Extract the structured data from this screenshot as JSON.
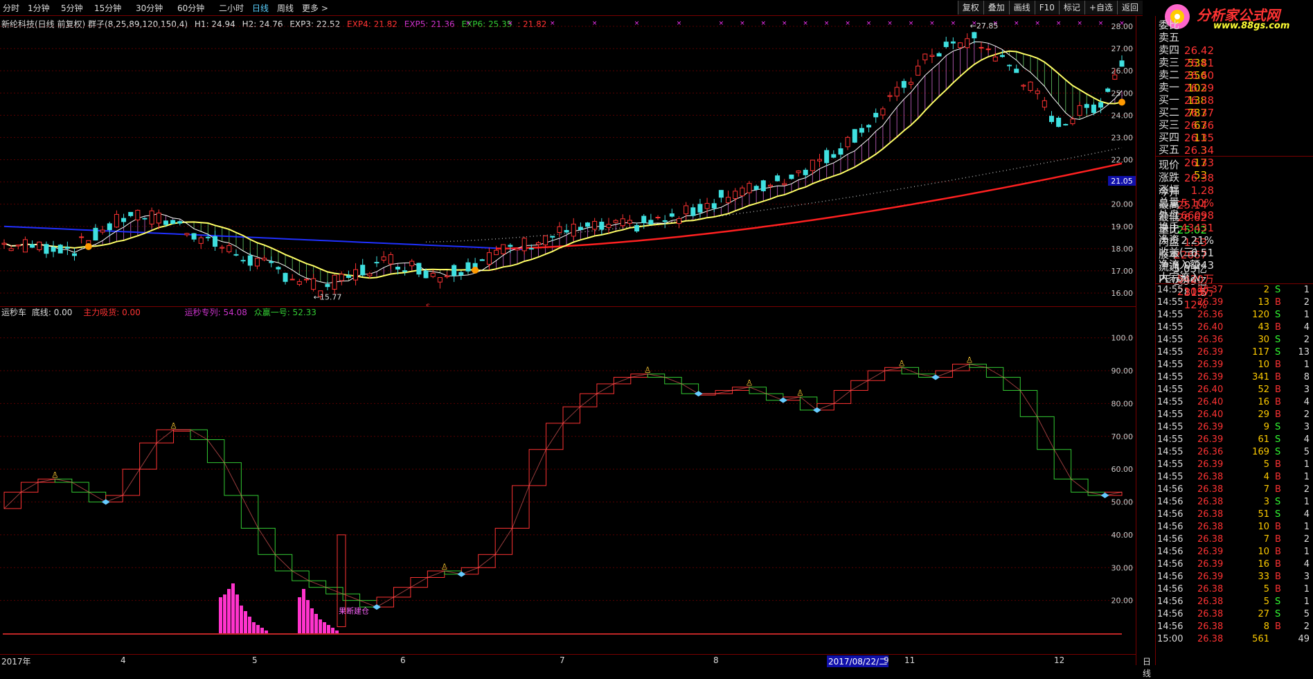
{
  "toolbar": {
    "periods": [
      "分时",
      "1分钟",
      "5分钟",
      "15分钟",
      "30分钟",
      "60分钟",
      "二小时",
      "日线",
      "周线",
      "更多 >"
    ],
    "active_period": "日线",
    "right_buttons": [
      "复权",
      "叠加",
      "画线",
      "F10",
      "标记",
      "+自选",
      "返回"
    ]
  },
  "logo": {
    "name": "分析家公式网",
    "url": "www.88gs.com"
  },
  "main_info": {
    "stock": "新纶科技(日线 前复权)",
    "indicator": "群子(8,25,89,120,150,4)",
    "h1": "H1: 24.94",
    "h2": "H2: 24.76",
    "exp3": "EXP3: 22.52",
    "exp4": "EXP4: 21.82",
    "exp5": "EXP5: 21.36",
    "exp6": "EXP6: 25.35",
    "extra": ": 21.82"
  },
  "sub_info": {
    "name": "运秒车",
    "base": "底线: 0.00",
    "main_force": "主力吸货: 0.00",
    "run": "运秒专列: 54.08",
    "crowd": "众赢一号: 52.33"
  },
  "main_chart": {
    "type": "candlestick",
    "y_ticks": [
      "28.00",
      "27.00",
      "26.00",
      "25.00",
      "24.00",
      "23.00",
      "22.00",
      "21.00",
      "20.00",
      "19.00",
      "18.00",
      "17.00",
      "16.00"
    ],
    "ylim": [
      16,
      28
    ],
    "price_marker": "21.05",
    "annotations": {
      "high": "27.85",
      "low": "15.77",
      "s_mark": "S"
    },
    "colors": {
      "up": "#ff3333",
      "down": "#3fe0e0",
      "ma1": "#ffffff",
      "ma2": "#ffff66",
      "ma3": "#ff2020",
      "ma4": "#2030ff"
    }
  },
  "sub_chart": {
    "type": "line",
    "y_ticks": [
      "100.0",
      "90.00",
      "80.00",
      "70.00",
      "60.00",
      "50.00",
      "40.00",
      "30.00",
      "20.00"
    ],
    "ylim": [
      10,
      105
    ],
    "buy_label": "果断建仓",
    "colors": {
      "up": "#ff3333",
      "down": "#33cc33",
      "bars": "#ff33cc"
    }
  },
  "chart_data": {
    "type": "line",
    "title": "",
    "series": [
      {
        "name": "运秒专列",
        "values": [
          48,
          53,
          56,
          57,
          56,
          53,
          50,
          52,
          60,
          68,
          72,
          72,
          69,
          62,
          52,
          42,
          34,
          29,
          26,
          24,
          22,
          20,
          18,
          21,
          24,
          27,
          29,
          28,
          30,
          34,
          42,
          55,
          66,
          74,
          79,
          83,
          86,
          88,
          89,
          88,
          86,
          83,
          83,
          84,
          85,
          83,
          81,
          82,
          78,
          80,
          84,
          87,
          90,
          91,
          89,
          88,
          90,
          92,
          91,
          88,
          84,
          76,
          66,
          57,
          53,
          52,
          53
        ]
      }
    ],
    "ylim": [
      10,
      105
    ]
  },
  "axis": {
    "labels": [
      "2017年",
      "4",
      "5",
      "6",
      "7",
      "8",
      "2017/08/22/二",
      "9",
      "11",
      "12"
    ],
    "period_label": "日线"
  },
  "quote": {
    "asks": [
      {
        "label": "委比",
        "price": "",
        "vol": ""
      },
      {
        "label": "卖五",
        "price": "26.42",
        "vol": "538"
      },
      {
        "label": "卖四",
        "price": "26.41",
        "vol": "356"
      },
      {
        "label": "卖三",
        "price": "26.40",
        "vol": "102"
      },
      {
        "label": "卖二",
        "price": "26.39",
        "vol": "138"
      },
      {
        "label": "卖一",
        "price": "26.38",
        "vol": "787"
      }
    ],
    "bids": [
      {
        "label": "买一",
        "price": "26.37",
        "vol": "67"
      },
      {
        "label": "买二",
        "price": "26.36",
        "vol": "11"
      },
      {
        "label": "买三",
        "price": "26.35",
        "vol": "3"
      },
      {
        "label": "买四",
        "price": "26.34",
        "vol": "17"
      },
      {
        "label": "买五",
        "price": "26.33",
        "vol": "53"
      }
    ],
    "stats": [
      {
        "l1": "现价",
        "v1": "26.38",
        "l2": "今开",
        "v2": "25.14"
      },
      {
        "l1": "涨跌",
        "v1": "1.28",
        "l2": "最高",
        "v2": "26.62"
      },
      {
        "l1": "涨幅",
        "v1": "5.10%",
        "l2": "最低",
        "v2": "25.02"
      },
      {
        "l1": "总量",
        "v1": "66098",
        "l2": "量比",
        "v2": "1.53"
      },
      {
        "l1": "外盘",
        "v1": "43431",
        "l2": "内盘",
        "v2": "22667"
      },
      {
        "l1": "换手",
        "v1": "2.21%",
        "l2": "股本",
        "v2": "5.03亿"
      },
      {
        "l1": "净资",
        "v1": "6.51",
        "l2": "流通",
        "v2": "2.99亿"
      },
      {
        "l1": "收益(三)",
        "v1": "0.243",
        "l2": "PE(动)",
        "v2": "81.5"
      },
      {
        "l1": "净流入额",
        "v1": "5420万",
        "l2": "",
        "v2": "31%"
      },
      {
        "l1": "大宗流入",
        "v1": "2103万",
        "l2": "",
        "v2": "12%"
      }
    ],
    "ticks": [
      {
        "t": "14:55",
        "p": "26.37",
        "v": "2",
        "s": "S",
        "n": "1"
      },
      {
        "t": "14:55",
        "p": "26.39",
        "v": "13",
        "s": "B",
        "n": "2"
      },
      {
        "t": "14:55",
        "p": "26.36",
        "v": "120",
        "s": "S",
        "n": "1"
      },
      {
        "t": "14:55",
        "p": "26.40",
        "v": "43",
        "s": "B",
        "n": "4"
      },
      {
        "t": "14:55",
        "p": "26.36",
        "v": "30",
        "s": "S",
        "n": "2"
      },
      {
        "t": "14:55",
        "p": "26.39",
        "v": "117",
        "s": "S",
        "n": "13"
      },
      {
        "t": "14:55",
        "p": "26.39",
        "v": "10",
        "s": "B",
        "n": "1"
      },
      {
        "t": "14:55",
        "p": "26.39",
        "v": "341",
        "s": "B",
        "n": "8"
      },
      {
        "t": "14:55",
        "p": "26.40",
        "v": "52",
        "s": "B",
        "n": "3"
      },
      {
        "t": "14:55",
        "p": "26.40",
        "v": "16",
        "s": "B",
        "n": "4"
      },
      {
        "t": "14:55",
        "p": "26.40",
        "v": "29",
        "s": "B",
        "n": "2"
      },
      {
        "t": "14:55",
        "p": "26.39",
        "v": "9",
        "s": "S",
        "n": "3"
      },
      {
        "t": "14:55",
        "p": "26.39",
        "v": "61",
        "s": "S",
        "n": "4"
      },
      {
        "t": "14:55",
        "p": "26.36",
        "v": "169",
        "s": "S",
        "n": "5"
      },
      {
        "t": "14:55",
        "p": "26.39",
        "v": "5",
        "s": "B",
        "n": "1"
      },
      {
        "t": "14:55",
        "p": "26.38",
        "v": "4",
        "s": "B",
        "n": "1"
      },
      {
        "t": "14:56",
        "p": "26.38",
        "v": "7",
        "s": "B",
        "n": "2"
      },
      {
        "t": "14:56",
        "p": "26.38",
        "v": "3",
        "s": "S",
        "n": "1"
      },
      {
        "t": "14:56",
        "p": "26.38",
        "v": "51",
        "s": "S",
        "n": "4"
      },
      {
        "t": "14:56",
        "p": "26.38",
        "v": "10",
        "s": "B",
        "n": "1"
      },
      {
        "t": "14:56",
        "p": "26.38",
        "v": "7",
        "s": "B",
        "n": "2"
      },
      {
        "t": "14:56",
        "p": "26.39",
        "v": "10",
        "s": "B",
        "n": "1"
      },
      {
        "t": "14:56",
        "p": "26.39",
        "v": "16",
        "s": "B",
        "n": "4"
      },
      {
        "t": "14:56",
        "p": "26.39",
        "v": "33",
        "s": "B",
        "n": "3"
      },
      {
        "t": "14:56",
        "p": "26.38",
        "v": "5",
        "s": "B",
        "n": "1"
      },
      {
        "t": "14:56",
        "p": "26.38",
        "v": "5",
        "s": "S",
        "n": "1"
      },
      {
        "t": "14:56",
        "p": "26.38",
        "v": "27",
        "s": "S",
        "n": "5"
      },
      {
        "t": "14:56",
        "p": "26.38",
        "v": "8",
        "s": "B",
        "n": "2"
      },
      {
        "t": "15:00",
        "p": "26.38",
        "v": "561",
        "s": "",
        "n": "49"
      }
    ]
  }
}
